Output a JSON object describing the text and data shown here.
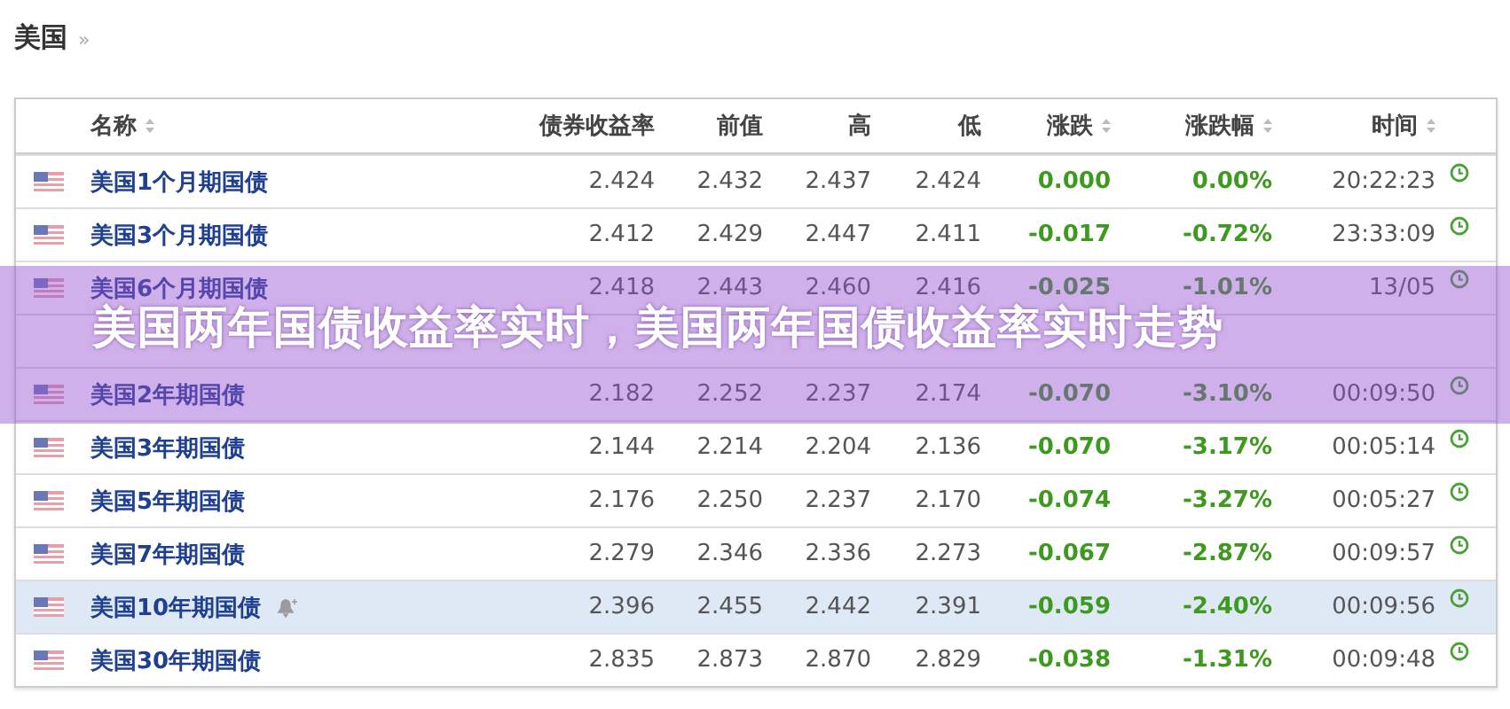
{
  "breadcrumb": {
    "title": "美国",
    "separator": "»"
  },
  "table": {
    "columns": [
      {
        "label": "名称",
        "sortable": true
      },
      {
        "label": "债券收益率",
        "sortable": false
      },
      {
        "label": "前值",
        "sortable": false
      },
      {
        "label": "高",
        "sortable": false
      },
      {
        "label": "低",
        "sortable": false
      },
      {
        "label": "涨跌",
        "sortable": true
      },
      {
        "label": "涨跌幅",
        "sortable": true
      },
      {
        "label": "时间",
        "sortable": true
      }
    ],
    "rows": [
      {
        "kind": "data",
        "name": "美国1个月期国债",
        "yield": "2.424",
        "prev": "2.432",
        "high": "2.437",
        "low": "2.424",
        "change": "0.000",
        "change_pct": "0.00%",
        "time": "20:22:23",
        "highlighted": false,
        "alert": false
      },
      {
        "kind": "data",
        "name": "美国3个月期国债",
        "yield": "2.412",
        "prev": "2.429",
        "high": "2.447",
        "low": "2.411",
        "change": "-0.017",
        "change_pct": "-0.72%",
        "time": "23:33:09",
        "highlighted": false,
        "alert": false
      },
      {
        "kind": "data",
        "name": "美国6个月期国债",
        "yield": "2.418",
        "prev": "2.443",
        "high": "2.460",
        "low": "2.416",
        "change": "-0.025",
        "change_pct": "-1.01%",
        "time": "13/05",
        "highlighted": false,
        "alert": false
      },
      {
        "kind": "covered"
      },
      {
        "kind": "data",
        "name": "美国2年期国债",
        "yield": "2.182",
        "prev": "2.252",
        "high": "2.237",
        "low": "2.174",
        "change": "-0.070",
        "change_pct": "-3.10%",
        "time": "00:09:50",
        "highlighted": false,
        "alert": false
      },
      {
        "kind": "data",
        "name": "美国3年期国债",
        "yield": "2.144",
        "prev": "2.214",
        "high": "2.204",
        "low": "2.136",
        "change": "-0.070",
        "change_pct": "-3.17%",
        "time": "00:05:14",
        "highlighted": false,
        "alert": false
      },
      {
        "kind": "data",
        "name": "美国5年期国债",
        "yield": "2.176",
        "prev": "2.250",
        "high": "2.237",
        "low": "2.170",
        "change": "-0.074",
        "change_pct": "-3.27%",
        "time": "00:05:27",
        "highlighted": false,
        "alert": false
      },
      {
        "kind": "data",
        "name": "美国7年期国债",
        "yield": "2.279",
        "prev": "2.346",
        "high": "2.336",
        "low": "2.273",
        "change": "-0.067",
        "change_pct": "-2.87%",
        "time": "00:09:57",
        "highlighted": false,
        "alert": false
      },
      {
        "kind": "data",
        "name": "美国10年期国债",
        "yield": "2.396",
        "prev": "2.455",
        "high": "2.442",
        "low": "2.391",
        "change": "-0.059",
        "change_pct": "-2.40%",
        "time": "00:09:56",
        "highlighted": true,
        "alert": true
      },
      {
        "kind": "data",
        "name": "美国30年期国债",
        "yield": "2.835",
        "prev": "2.873",
        "high": "2.870",
        "low": "2.829",
        "change": "-0.038",
        "change_pct": "-1.31%",
        "time": "00:09:48",
        "highlighted": false,
        "alert": false
      }
    ]
  },
  "banner": {
    "text": "美国两年国债收益率实时，美国两年国债收益率实时走势"
  }
}
